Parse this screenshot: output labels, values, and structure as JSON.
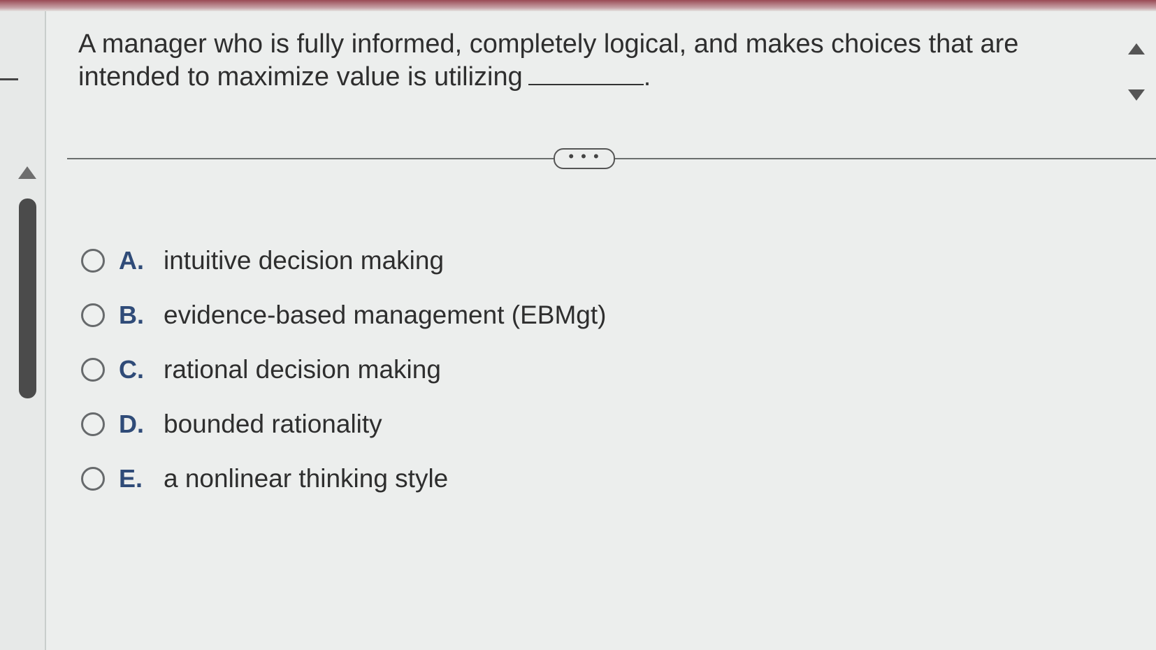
{
  "question": {
    "text": "A manager who is fully informed, completely logical, and makes choices that are intended to maximize value is utilizing",
    "blank_suffix": "."
  },
  "divider": {
    "handle_label": "• • •"
  },
  "options": [
    {
      "letter": "A.",
      "text": "intuitive decision making"
    },
    {
      "letter": "B.",
      "text": "evidence-based management (EBMgt)"
    },
    {
      "letter": "C.",
      "text": "rational decision making"
    },
    {
      "letter": "D.",
      "text": "bounded rationality"
    },
    {
      "letter": "E.",
      "text": "a nonlinear thinking style"
    }
  ],
  "colors": {
    "option_letter": "#2f4b78",
    "text": "#2e2e2e",
    "top_bar": "#9a4a55"
  }
}
